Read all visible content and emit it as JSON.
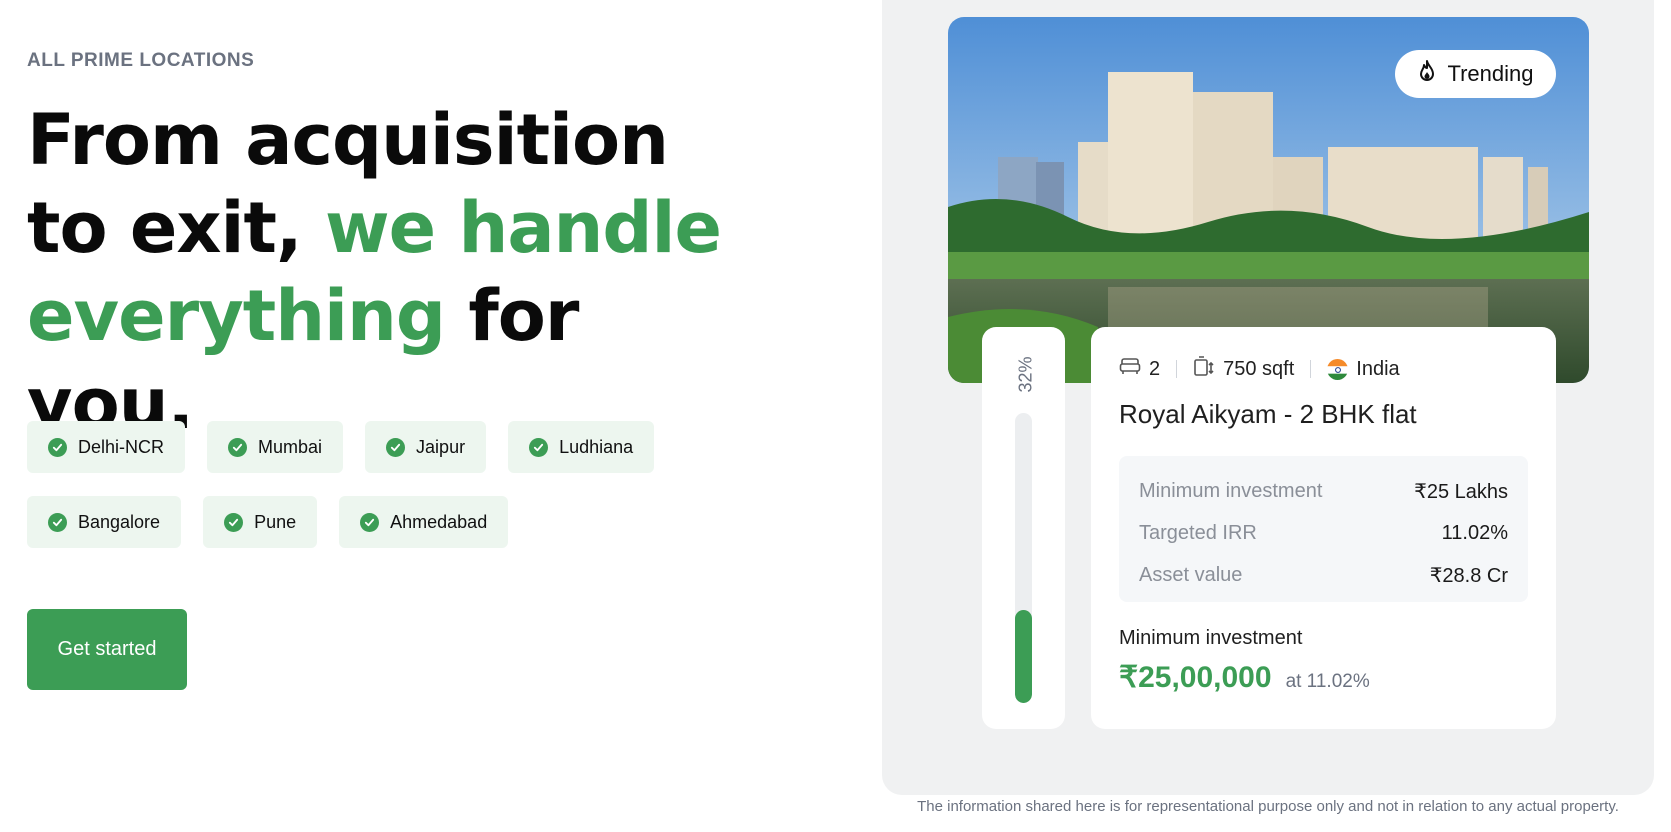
{
  "hero": {
    "eyebrow": "ALL PRIME LOCATIONS",
    "headline_part1": "From acquisition to exit, ",
    "headline_green": "we handle everything",
    "headline_part2": " for you.",
    "accent_color": "#3c9d55"
  },
  "locations": [
    "Delhi-NCR",
    "Mumbai",
    "Jaipur",
    "Ludhiana",
    "Bangalore",
    "Pune",
    "Ahmedabad"
  ],
  "cta": {
    "label": "Get started"
  },
  "property": {
    "badge": "Trending",
    "badge_icon": "flame-icon",
    "funded_percent_label": "32%",
    "funded_fraction": 0.32,
    "bedrooms": "2",
    "area": "750 sqft",
    "country": "India",
    "title": "Royal Aikyam - 2 BHK flat",
    "details": [
      {
        "label": "Minimum investment",
        "value": "₹25 Lakhs"
      },
      {
        "label": "Targeted IRR",
        "value": "11.02%"
      },
      {
        "label": "Asset value",
        "value": "₹28.8 Cr"
      }
    ],
    "min_investment_label": "Minimum investment",
    "min_investment_amount": "₹25,00,000",
    "min_investment_rate": "at 11.02%"
  },
  "disclaimer": "The information shared here is for representational purpose only and not in relation to any actual property."
}
